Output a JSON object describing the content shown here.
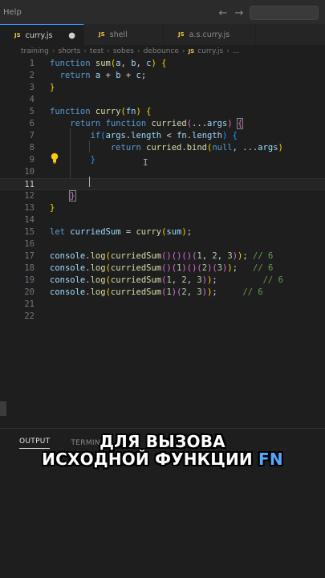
{
  "titlebar": {
    "menu": "Help"
  },
  "tabs": [
    {
      "label": "curry.js",
      "active": true
    },
    {
      "label": "shell",
      "active": false
    },
    {
      "label": "a.s.curry.js",
      "active": false
    }
  ],
  "breadcrumb": [
    "training",
    "shorts",
    "test",
    "sobes",
    "debounce",
    "curry.js",
    "..."
  ],
  "editor": {
    "current_line": 11,
    "line_numbers": [
      "1",
      "2",
      "3",
      "4",
      "5",
      "6",
      "7",
      "8",
      "9",
      "10",
      "11",
      "12",
      "13",
      "14",
      "15",
      "16",
      "17",
      "18",
      "19",
      "20",
      "21",
      "22"
    ]
  },
  "panel": {
    "tabs": [
      "OUTPUT",
      "TERMINAL"
    ]
  },
  "caption": {
    "line1": "ДЛЯ ВЫЗОВА",
    "line2_main": "ИСХОДНОЙ ФУНКЦИИ",
    "line2_highlight": "FN"
  }
}
